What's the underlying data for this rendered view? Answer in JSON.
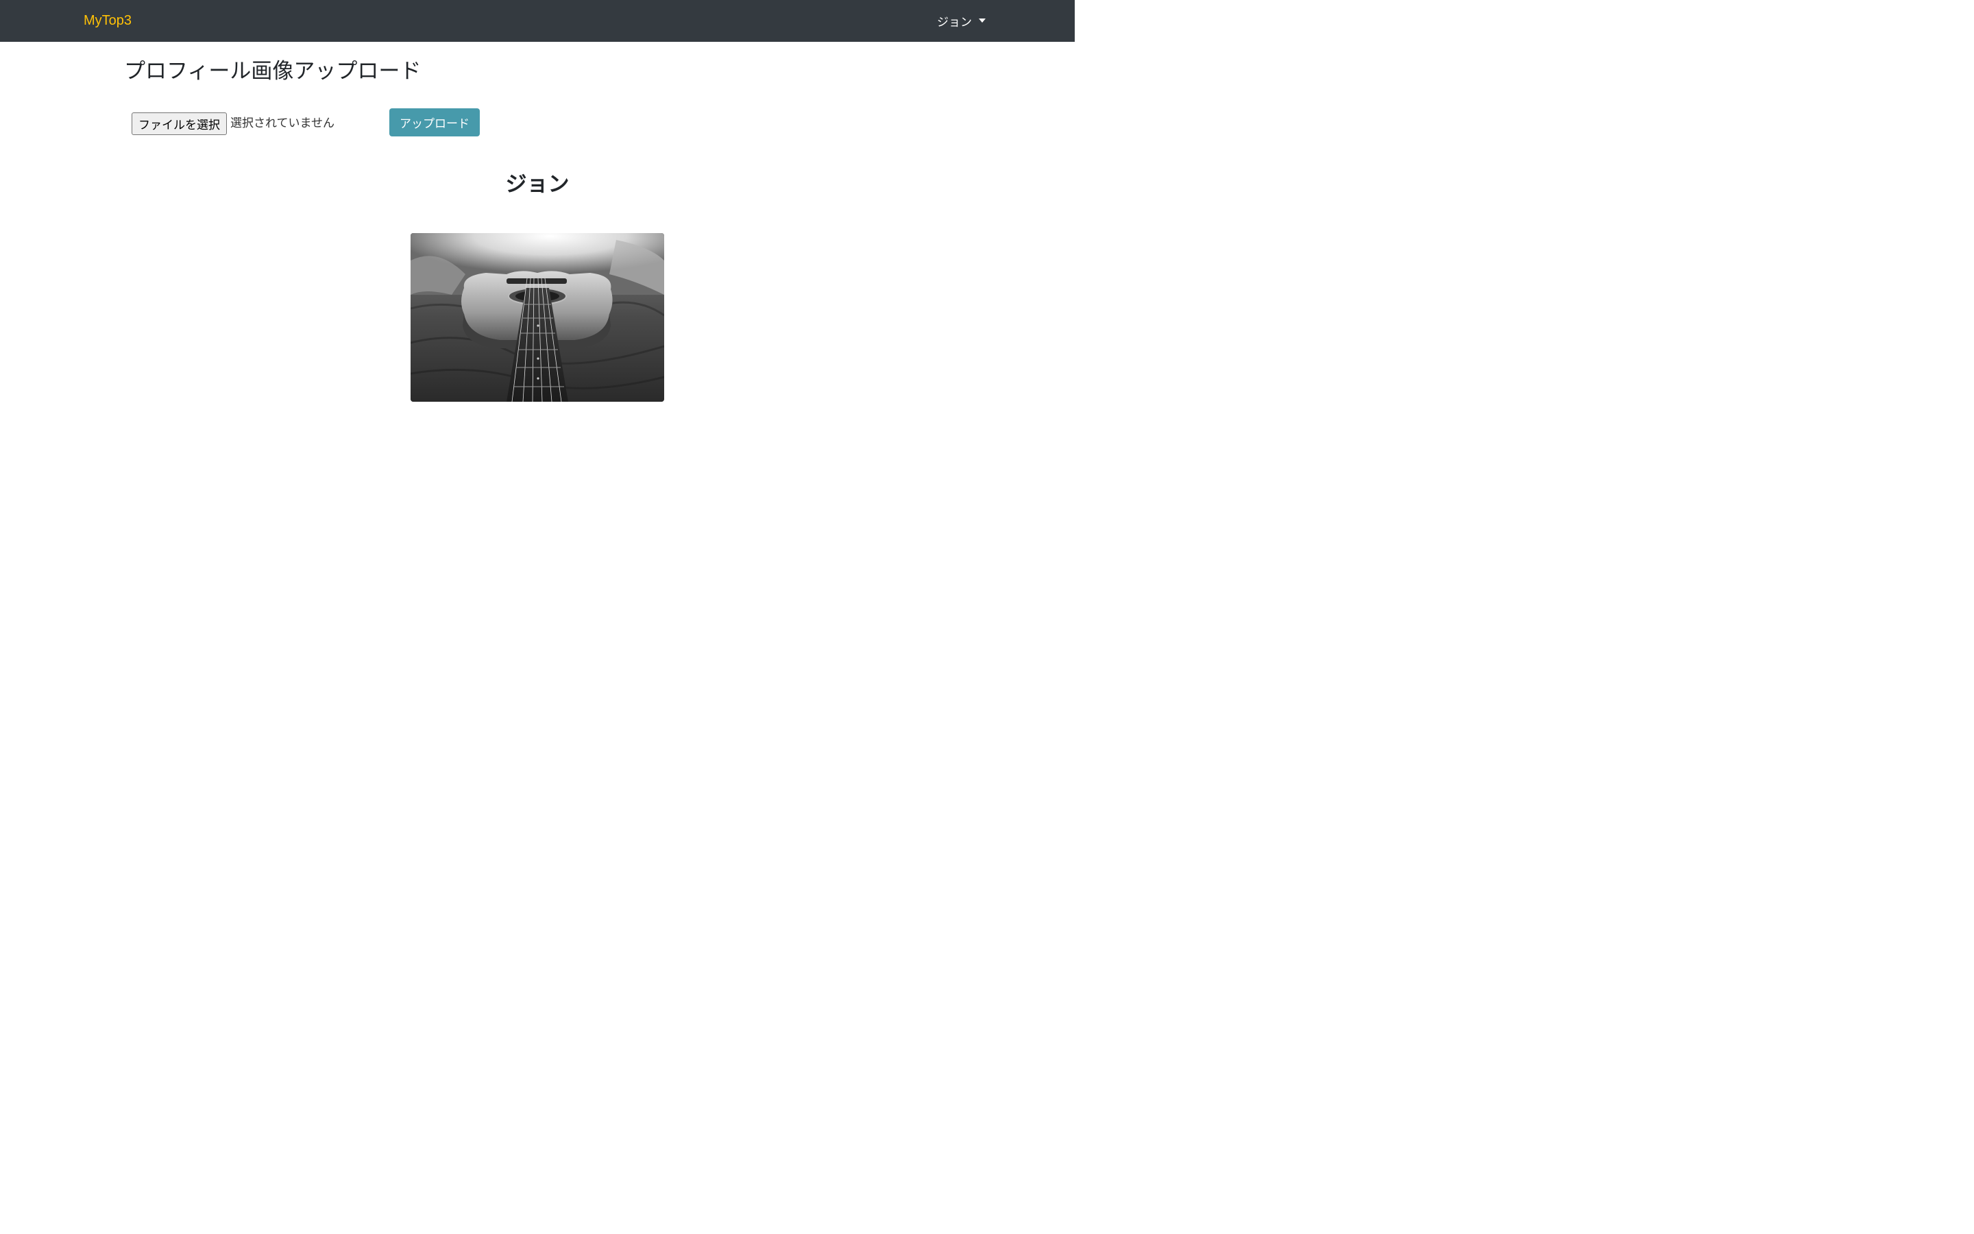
{
  "navbar": {
    "brand": "MyTop3",
    "user_menu_label": "ジョン",
    "accent_color": "#ffc107",
    "background_color": "#343a40"
  },
  "main": {
    "title": "プロフィール画像アップロード",
    "file_input": {
      "button_label": "ファイルを選択",
      "status_text": "選択されていません"
    },
    "upload_button_label": "アップロード",
    "upload_button_color": "#479aab",
    "username": "ジョン",
    "profile_image": {
      "description_icon": "guitar-photo"
    }
  }
}
